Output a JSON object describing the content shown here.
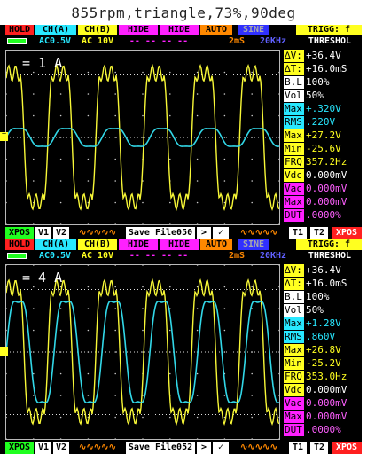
{
  "title": "855rpm,triangle,73%,90deg",
  "panels": [
    {
      "hold": "HOLD",
      "cha": "CH(A)",
      "chb": "CH(B)",
      "hide1": "HIDE",
      "hide2": "HIDE",
      "auto": "AUTO",
      "sine": "SINE",
      "trig": "TRIGG: f",
      "couple_a": "AC0.5V",
      "couple_b": "AC 10V",
      "dashes": "-- -- -- --",
      "timebase": "2mS",
      "freq": "20KHz",
      "thres": "THRESHOL",
      "scale_label": "= 1 A",
      "readings": [
        {
          "k": "∆V:",
          "v": "+36.4V"
        },
        {
          "k": "∆T:",
          "v": "+16.0mS"
        },
        {
          "k": "B.L",
          "v": "100%"
        },
        {
          "k": "Vol",
          "v": "50%"
        },
        {
          "k": "Max",
          "v": "+.320V"
        },
        {
          "k": "RMS",
          "v": ".220V"
        },
        {
          "k": "Max",
          "v": "+27.2V"
        },
        {
          "k": "Min",
          "v": "-25.6V"
        },
        {
          "k": "FRQ",
          "v": "357.2Hz"
        },
        {
          "k": "Vdc",
          "v": "0.000mV"
        },
        {
          "k": "Vac",
          "v": "0.000mV"
        },
        {
          "k": "Max",
          "v": "0.000mV"
        },
        {
          "k": "DUT",
          "v": ".0000%"
        }
      ],
      "footer": {
        "xpos": "XPOS",
        "v1": "V1",
        "v2": "V2",
        "save": "Save File050",
        "gt": ">",
        "t1": "T1",
        "t2": "T2",
        "xpos2": "XPOS"
      },
      "yellow_wave": {
        "cycles": 5.7,
        "high": 0.82,
        "low": -0.82
      },
      "cyan_wave": {
        "cycles": 5.7,
        "amp": 0.12
      }
    },
    {
      "hold": "HOLD",
      "cha": "CH(A)",
      "chb": "CH(B)",
      "hide1": "HIDE",
      "hide2": "HIDE",
      "auto": "AUTO",
      "sine": "SINE",
      "trig": "TRIGG: f",
      "couple_a": "AC0.5V",
      "couple_b": "AC 10V",
      "dashes": "-- -- -- --",
      "timebase": "2mS",
      "freq": "20KHz",
      "thres": "THRESHOL",
      "scale_label": "= 4 A",
      "readings": [
        {
          "k": "∆V:",
          "v": "+36.4V"
        },
        {
          "k": "∆T:",
          "v": "+16.0mS"
        },
        {
          "k": "B.L",
          "v": "100%"
        },
        {
          "k": "Vol",
          "v": "50%"
        },
        {
          "k": "Max",
          "v": "+1.28V"
        },
        {
          "k": "RMS",
          "v": ".860V"
        },
        {
          "k": "Max",
          "v": "+26.8V"
        },
        {
          "k": "Min",
          "v": "-25.2V"
        },
        {
          "k": "FRQ",
          "v": "353.0Hz"
        },
        {
          "k": "Vdc",
          "v": "0.000mV"
        },
        {
          "k": "Vac",
          "v": "0.000mV"
        },
        {
          "k": "Max",
          "v": "0.000mV"
        },
        {
          "k": "DUT",
          "v": ".0000%"
        }
      ],
      "footer": {
        "xpos": "XPOS",
        "v1": "V1",
        "v2": "V2",
        "save": "Save File052",
        "gt": ">",
        "t1": "T1",
        "t2": "T2",
        "xpos2": "XPOS"
      },
      "yellow_wave": {
        "cycles": 5.7,
        "high": 0.82,
        "low": -0.82
      },
      "cyan_wave": {
        "cycles": 5.7,
        "amp": 0.68
      }
    }
  ],
  "colors": {
    "hold": "#ff2020",
    "cha": "#28e8ff",
    "chb": "#ffff20",
    "hide": "#ff20ff",
    "auto": "#ff8800",
    "sine": "#3030ff",
    "trig": "#ffff20",
    "yellow": "#f7f737",
    "cyan": "#32d8e8",
    "green": "#20ff20",
    "grid": "#c8c8c8"
  }
}
